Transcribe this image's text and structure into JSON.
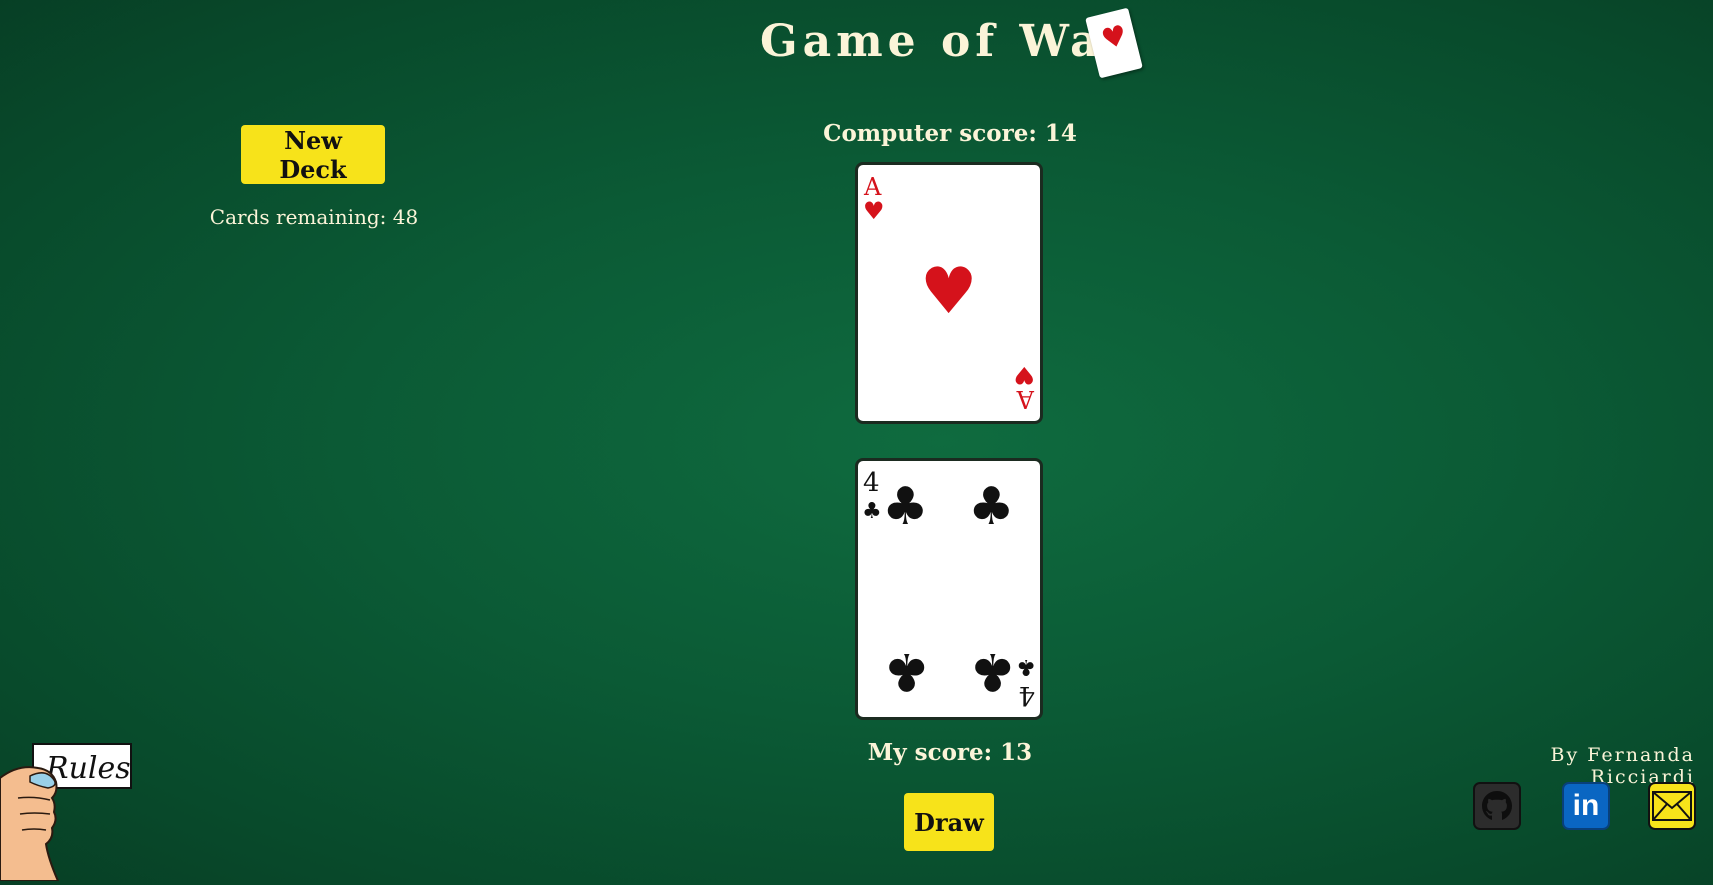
{
  "header": {
    "title": "Game of War",
    "title_card_icon": "ace-of-hearts-card-icon"
  },
  "deck": {
    "new_deck_label": "New Deck",
    "remaining_text": "Cards remaining: 48"
  },
  "scores": {
    "computer_text": "Computer score: 14",
    "player_text": "My score: 13"
  },
  "cards": {
    "computer": {
      "rank": "A",
      "suit": "hearts",
      "symbol": "♥",
      "color": "#d5121b"
    },
    "player": {
      "rank": "4",
      "suit": "clubs",
      "symbol": "♣",
      "color": "#111111"
    }
  },
  "actions": {
    "draw_label": "Draw"
  },
  "rules": {
    "label": "Rules"
  },
  "footer": {
    "byline": "By Fernanda Ricciardi",
    "links": [
      {
        "icon": "github-icon"
      },
      {
        "icon": "linkedin-icon",
        "text": "in"
      },
      {
        "icon": "mail-icon"
      }
    ]
  },
  "colors": {
    "felt": "#0b5a35",
    "button": "#f7e31a",
    "text": "#fbf4d8"
  }
}
